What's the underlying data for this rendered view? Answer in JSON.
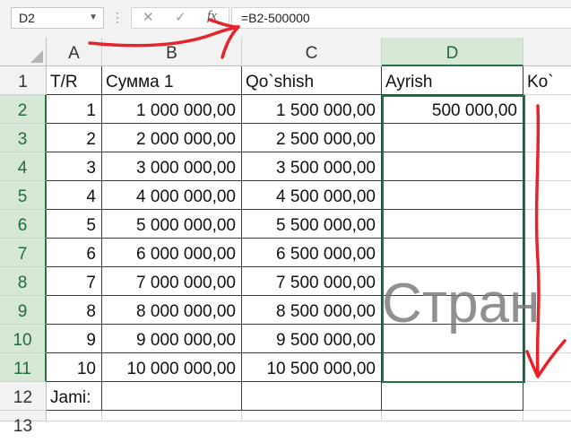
{
  "formula_bar": {
    "name_box": "D2",
    "formula": "=B2-500000",
    "fx_label": "fx"
  },
  "columns": [
    "A",
    "B",
    "C",
    "D"
  ],
  "partial_column": "",
  "rows": [
    "1",
    "2",
    "3",
    "4",
    "5",
    "6",
    "7",
    "8",
    "9",
    "10",
    "11",
    "12",
    "13"
  ],
  "header_row": {
    "a": "T/R",
    "b": "Сумма 1",
    "c": "Qo`shish",
    "d": "Ayrish",
    "e": "Ko`"
  },
  "data_rows": [
    {
      "a": "1",
      "b": "1 000 000,00",
      "c": "1 500 000,00",
      "d": "500 000,00"
    },
    {
      "a": "2",
      "b": "2 000 000,00",
      "c": "2 500 000,00",
      "d": ""
    },
    {
      "a": "3",
      "b": "3 000 000,00",
      "c": "3 500 000,00",
      "d": ""
    },
    {
      "a": "4",
      "b": "4 000 000,00",
      "c": "4 500 000,00",
      "d": ""
    },
    {
      "a": "5",
      "b": "5 000 000,00",
      "c": "5 500 000,00",
      "d": ""
    },
    {
      "a": "6",
      "b": "6 000 000,00",
      "c": "6 500 000,00",
      "d": ""
    },
    {
      "a": "7",
      "b": "7 000 000,00",
      "c": "7 500 000,00",
      "d": ""
    },
    {
      "a": "8",
      "b": "8 000 000,00",
      "c": "8 500 000,00",
      "d": ""
    },
    {
      "a": "9",
      "b": "9 000 000,00",
      "c": "9 500 000,00",
      "d": ""
    },
    {
      "a": "10",
      "b": "10 000 000,00",
      "c": "10 500 000,00",
      "d": ""
    }
  ],
  "total_row": {
    "a": "Jami:"
  },
  "watermark": "Стран",
  "annotation_color": "#e8222a",
  "accent_color": "#217346"
}
